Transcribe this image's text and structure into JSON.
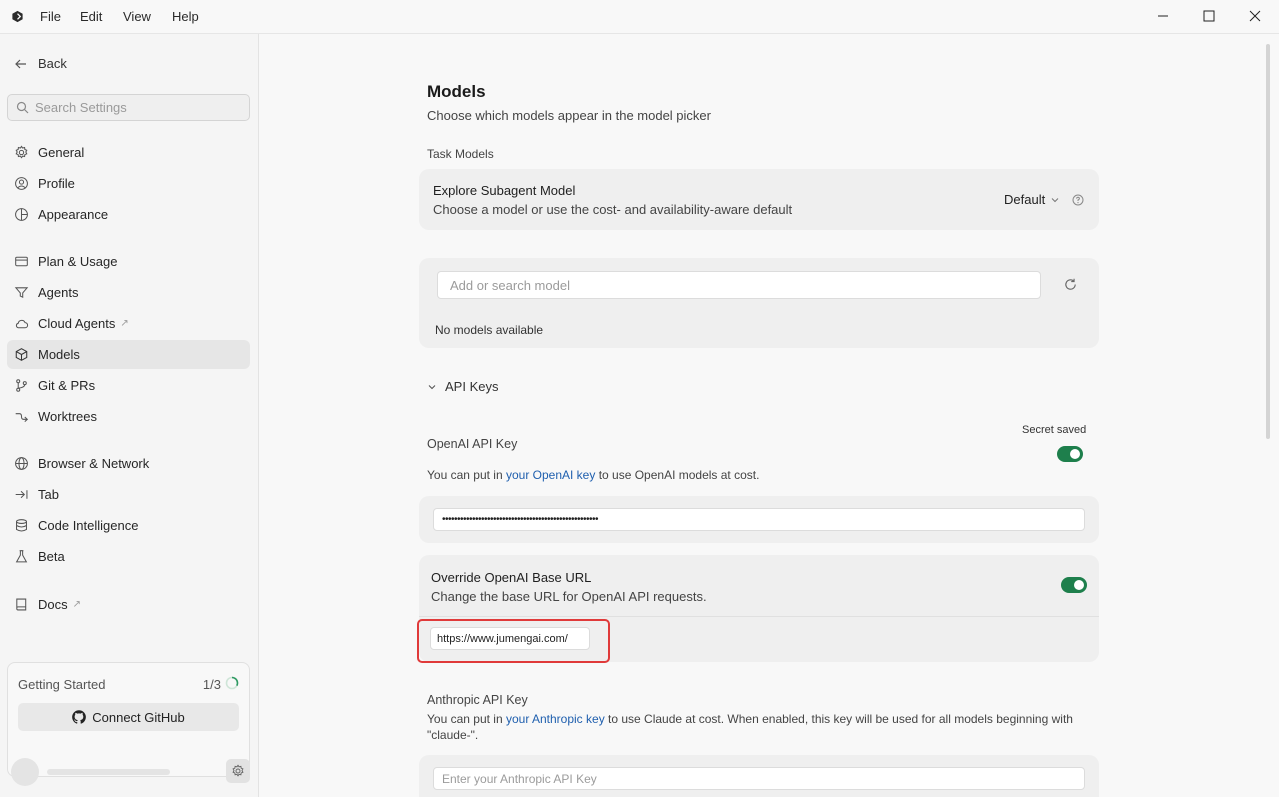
{
  "menu": {
    "file": "File",
    "edit": "Edit",
    "view": "View",
    "help": "Help"
  },
  "sidebar": {
    "back": "Back",
    "search_placeholder": "Search Settings",
    "items": [
      {
        "label": "General"
      },
      {
        "label": "Profile"
      },
      {
        "label": "Appearance"
      },
      {
        "label": "Plan & Usage"
      },
      {
        "label": "Agents"
      },
      {
        "label": "Cloud Agents"
      },
      {
        "label": "Models"
      },
      {
        "label": "Git & PRs"
      },
      {
        "label": "Worktrees"
      },
      {
        "label": "Browser & Network"
      },
      {
        "label": "Tab"
      },
      {
        "label": "Code Intelligence"
      },
      {
        "label": "Beta"
      },
      {
        "label": "Docs"
      }
    ],
    "getting_started": {
      "title": "Getting Started",
      "count": "1/3",
      "progress": 0.33,
      "button": "Connect GitHub"
    }
  },
  "main": {
    "title": "Models",
    "subtitle": "Choose which models appear in the model picker",
    "task_models_label": "Task Models",
    "explore": {
      "title": "Explore Subagent Model",
      "desc": "Choose a model or use the cost- and availability-aware default",
      "value": "Default"
    },
    "model_search": {
      "placeholder": "Add or search model",
      "empty": "No models available"
    },
    "api_keys_label": "API Keys",
    "openai": {
      "title": "OpenAI API Key",
      "secret_saved": "Secret saved",
      "desc_prefix": "You can put in ",
      "desc_link": "your OpenAI key",
      "desc_suffix": " to use OpenAI models at cost.",
      "key_value": "••••••••••••••••••••••••••••••••••••••••••••••••••••",
      "enabled": true
    },
    "override": {
      "title": "Override OpenAI Base URL",
      "desc": "Change the base URL for OpenAI API requests.",
      "url_value": "https://www.jumengai.com/",
      "enabled": true
    },
    "anthropic": {
      "title": "Anthropic API Key",
      "desc_prefix": "You can put in ",
      "desc_link": "your Anthropic key",
      "desc_suffix": " to use Claude at cost. When enabled, this key will be used for all models beginning with",
      "desc_line2": "\"claude-\".",
      "placeholder": "Enter your Anthropic API Key"
    }
  },
  "colors": {
    "toggle_on": "#1e7f4c",
    "link": "#1f5fae",
    "highlight": "#e03a3a"
  }
}
